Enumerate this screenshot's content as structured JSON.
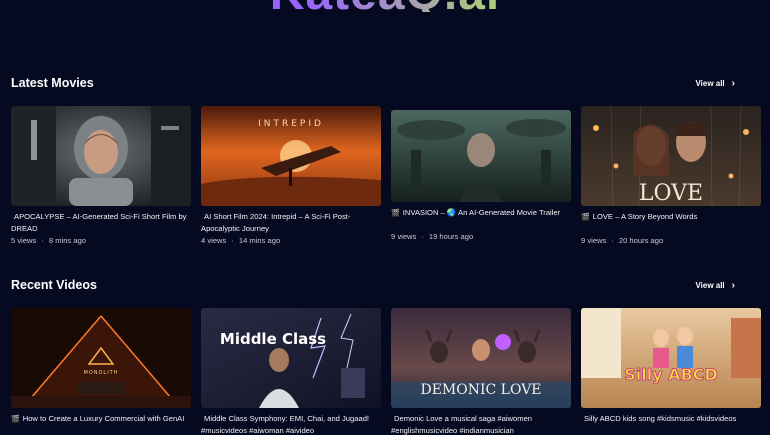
{
  "brand": {
    "logo_text": "KateaQ.ai"
  },
  "sections": [
    {
      "title": "Latest Movies",
      "view_all": "View all",
      "items": [
        {
          "title": "APOCALYPSE – AI-Generated Sci-Fi Short Film by DREAD",
          "views": "5 views",
          "age": "8 mins ago",
          "thumb_icon": "astronaut-portrait",
          "clap": ""
        },
        {
          "title": "AI Short Film 2024: Intrepid – A Sci-Fi Post-Apocalyptic Journey",
          "views": "4 views",
          "age": "14 mins ago",
          "thumb_icon": "desert-ship",
          "clap": "",
          "thumb_text": "INTREPID"
        },
        {
          "title": "INVASION – 🌏 An AI-Generated Movie Trailer",
          "views": "9 views",
          "age": "19 hours ago",
          "thumb_icon": "alien-child",
          "clap": "🎬"
        },
        {
          "title": "LOVE – A Story Beyond Words",
          "views": "9 views",
          "age": "20 hours ago",
          "thumb_icon": "couple-rain",
          "clap": "🎬",
          "thumb_text": "LOVE"
        }
      ]
    },
    {
      "title": "Recent Videos",
      "view_all": "View all",
      "items": [
        {
          "title": "How to Create a Luxury Commercial with GenAI",
          "clap": "🎬",
          "thumb_icon": "pyramid-car",
          "thumb_text": "MONOLITH"
        },
        {
          "title": "Middle Class Symphony: EMI, Chai, and Jugaad! #musicvideos #aiwoman #aivideo",
          "clap": "",
          "thumb_icon": "middle-class-poster",
          "thumb_text": "Middle Class"
        },
        {
          "title": "Demonic Love a musical saga #aiwomen #englishmusicvideo #indianmusician",
          "clap": "",
          "thumb_icon": "demon-couple",
          "thumb_text": "DEMONIC LOVE"
        },
        {
          "title": "Silly ABCD kids song #kidsmusic #kidsvideos",
          "clap": "",
          "thumb_icon": "kids-classroom",
          "thumb_text": "Silly ABCD"
        }
      ]
    }
  ],
  "colors": {
    "background": "#060a20",
    "accent_purple": "#9a63ff",
    "accent_lime": "#c8ff3a"
  }
}
